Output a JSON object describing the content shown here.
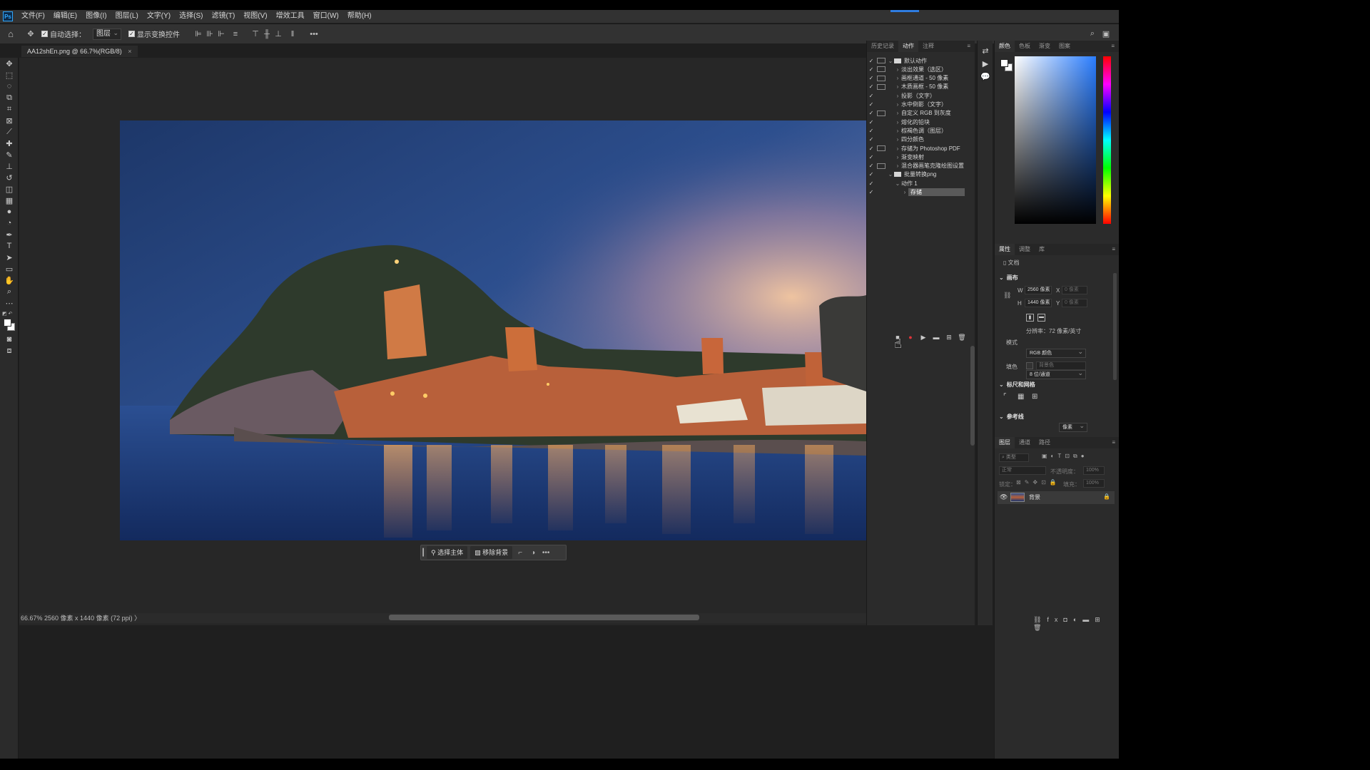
{
  "app": {
    "menu": [
      "文件(F)",
      "编辑(E)",
      "图像(I)",
      "图层(L)",
      "文字(Y)",
      "选择(S)",
      "滤镜(T)",
      "视图(V)",
      "增效工具",
      "窗口(W)",
      "帮助(H)"
    ],
    "logo_text": "Ps"
  },
  "options_bar": {
    "auto_select_label": "自动选择：",
    "auto_select_target": "图层",
    "show_transform_label": "显示变换控件",
    "more": "•••"
  },
  "document": {
    "tab_title": "AA12shEn.png @ 66.7%(RGB/8)",
    "tab_close": "×",
    "status_text": "66.67%   2560 像素 x 1440 像素 (72 ppi)   〉",
    "zoom_percent": 66.67
  },
  "context_bar": {
    "select_subject": "选择主体",
    "remove_background": "移除背景",
    "more": "•••"
  },
  "actions_panel": {
    "tabs": [
      "历史记录",
      "动作",
      "注释"
    ],
    "active_tab": "动作",
    "rows": [
      {
        "label": "默认动作",
        "level": 0,
        "folder": true,
        "expanded": true,
        "dialog": true
      },
      {
        "label": "淡出效果（选区）",
        "level": 1,
        "dialog": true
      },
      {
        "label": "画框通道 - 50 像素",
        "level": 1,
        "dialog": true
      },
      {
        "label": "木质画框 - 50 像素",
        "level": 1,
        "dialog": true
      },
      {
        "label": "投影（文字）",
        "level": 1,
        "dialog": false
      },
      {
        "label": "水中倒影（文字）",
        "level": 1,
        "dialog": false
      },
      {
        "label": "自定义 RGB 到灰度",
        "level": 1,
        "dialog": true
      },
      {
        "label": "熔化的铅块",
        "level": 1,
        "dialog": false
      },
      {
        "label": "棕褐色调（图层）",
        "level": 1,
        "dialog": false
      },
      {
        "label": "四分颜色",
        "level": 1,
        "dialog": false
      },
      {
        "label": "存储为 Photoshop PDF",
        "level": 1,
        "dialog": true
      },
      {
        "label": "渐变映射",
        "level": 1,
        "dialog": false
      },
      {
        "label": "混合器画笔克隆绘图设置",
        "level": 1,
        "dialog": true
      },
      {
        "label": "批量转换png",
        "level": 0,
        "folder": true,
        "expanded": true,
        "dialog": false
      },
      {
        "label": "动作 1",
        "level": 1,
        "expanded": true,
        "dialog": false
      },
      {
        "label": "存储",
        "level": 2,
        "dialog": false,
        "selected": true
      }
    ]
  },
  "color_panel": {
    "tabs": [
      "颜色",
      "色板",
      "渐变",
      "图案"
    ],
    "active_tab": "颜色",
    "hue_color": "#2a7dff"
  },
  "properties_panel": {
    "tabs": [
      "属性",
      "调整",
      "库"
    ],
    "active_tab": "属性",
    "doc_label": "文档",
    "canvas_title": "画布",
    "w_label": "W",
    "w_value": "2560 像素",
    "h_label": "H",
    "h_value": "1440 像素",
    "x_label": "X",
    "x_value": "0 像素",
    "y_label": "Y",
    "y_value": "0 像素",
    "resolution": "分辨率：72 像素/英寸",
    "mode_label": "模式",
    "mode_value": "RGB 颜色",
    "depth_value": "8 位/通道",
    "fill_label": "填色",
    "fill_value": "背景色",
    "rulers_title": "标尺和网格",
    "rulers_unit": "像素",
    "guides_title": "参考线"
  },
  "layers_panel": {
    "tabs": [
      "图层",
      "通道",
      "路径"
    ],
    "active_tab": "图层",
    "search_placeholder": "类型",
    "blend_mode": "正常",
    "opacity_label": "不透明度：",
    "opacity_value": "100%",
    "lock_label": "锁定：",
    "fill_label": "填充：",
    "fill_value": "100%",
    "layers": [
      {
        "name": "背景",
        "visible": true,
        "locked": true
      }
    ]
  }
}
